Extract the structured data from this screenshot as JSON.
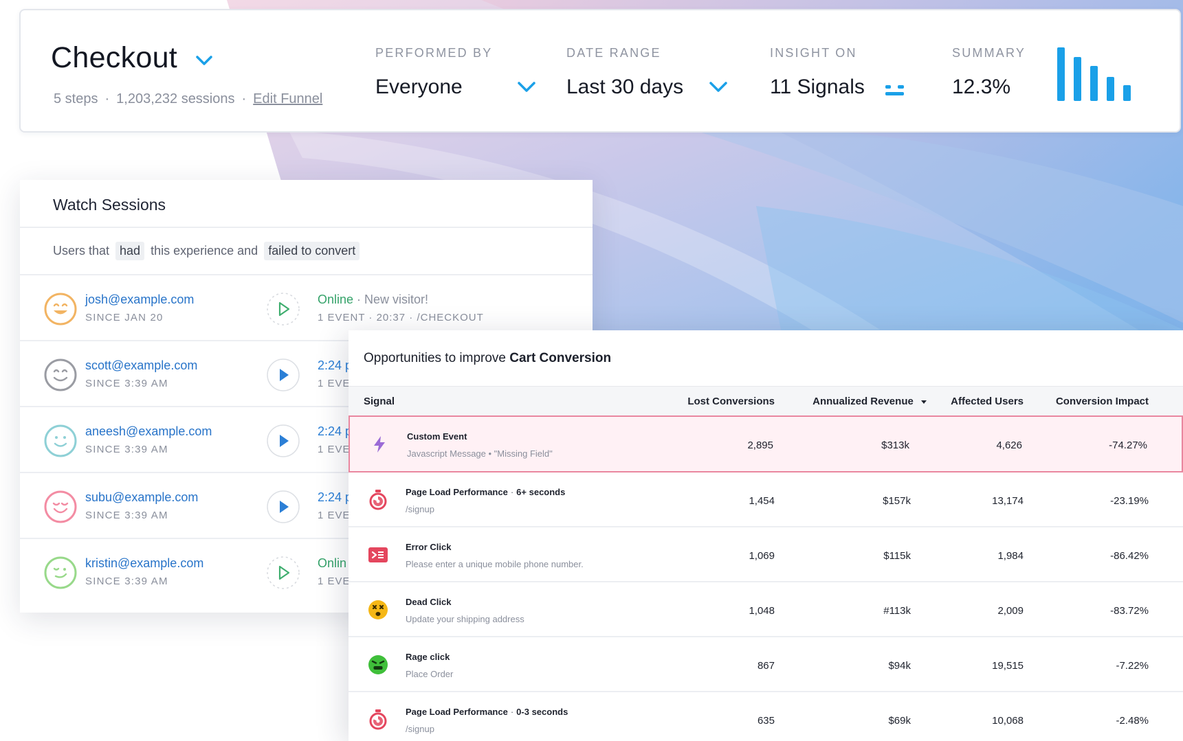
{
  "funnel": {
    "title": "Checkout",
    "steps": "5 steps",
    "sessions": "1,203,232 sessions",
    "edit_link": "Edit Funnel"
  },
  "filters": {
    "performed_by": {
      "label": "PERFORMED BY",
      "value": "Everyone"
    },
    "date_range": {
      "label": "DATE RANGE",
      "value": "Last 30 days"
    },
    "insight_on": {
      "label": "INSIGHT ON",
      "value": "11 Signals"
    },
    "summary": {
      "label": "SUMMARY",
      "value": "12.3%",
      "bar_levels": [
        1.0,
        0.82,
        0.65,
        0.45,
        0.3
      ]
    }
  },
  "watch_sessions": {
    "title": "Watch Sessions",
    "filter": {
      "prefix": "Users that",
      "chip1": "had",
      "middle": "this experience and",
      "chip2": "failed to convert"
    },
    "rows": [
      {
        "email": "josh@example.com",
        "since": "SINCE JAN 20",
        "status_main": "Online",
        "status_rest": " · New visitor!",
        "event": "1 EVENT · 20:37 · /CHECKOUT",
        "avatar_color": "#f2b463",
        "live": true
      },
      {
        "email": "scott@example.com",
        "since": "SINCE 3:39 AM",
        "status_main": "2:24 p",
        "status_rest": "",
        "event": "1 EVEN",
        "avatar_color": "#9a9ca3",
        "live": false
      },
      {
        "email": "aneesh@example.com",
        "since": "SINCE 3:39 AM",
        "status_main": "2:24 p",
        "status_rest": "",
        "event": "1 EVEN",
        "avatar_color": "#8ed0d6",
        "live": false
      },
      {
        "email": "subu@example.com",
        "since": "SINCE 3:39 AM",
        "status_main": "2:24 p",
        "status_rest": "",
        "event": "1 EVEN",
        "avatar_color": "#f38ca3",
        "live": false
      },
      {
        "email": "kristin@example.com",
        "since": "SINCE 3:39 AM",
        "status_main": "Onlin",
        "status_rest": "",
        "event": "1 EVEN",
        "avatar_color": "#98d98a",
        "live": true
      }
    ]
  },
  "opportunities": {
    "title_prefix": "Opportunities to improve ",
    "title_bold": "Cart Conversion",
    "columns": {
      "signal": "Signal",
      "lost": "Lost Conversions",
      "revenue": "Annualized Revenue",
      "affected": "Affected Users",
      "impact": "Conversion Impact"
    },
    "rows": [
      {
        "name": "Custom Event",
        "detail": "",
        "desc": "Javascript  Message • \"Missing Field\"",
        "lost": "2,895",
        "revenue": "$313k",
        "affected": "4,626",
        "impact": "-74.27%",
        "icon": "bolt-icon"
      },
      {
        "name": "Page Load Performance",
        "detail": "6+ seconds",
        "desc": "/signup",
        "lost": "1,454",
        "revenue": "$157k",
        "affected": "13,174",
        "impact": "-23.19%",
        "icon": "stopwatch-icon"
      },
      {
        "name": "Error Click",
        "detail": "",
        "desc": "Please enter a unique mobile phone number.",
        "lost": "1,069",
        "revenue": "$115k",
        "affected": "1,984",
        "impact": "-86.42%",
        "icon": "error-console-icon"
      },
      {
        "name": "Dead Click",
        "detail": "",
        "desc": "Update your shipping address",
        "lost": "1,048",
        "revenue": "#113k",
        "affected": "2,009",
        "impact": "-83.72%",
        "icon": "dead-face-icon"
      },
      {
        "name": "Rage click",
        "detail": "",
        "desc": "Place Order",
        "lost": "867",
        "revenue": "$94k",
        "affected": "19,515",
        "impact": "-7.22%",
        "icon": "angry-face-icon"
      },
      {
        "name": "Page Load Performance",
        "detail": "0-3 seconds",
        "desc": "/signup",
        "lost": "635",
        "revenue": "$69k",
        "affected": "10,068",
        "impact": "-2.48%",
        "icon": "stopwatch-icon"
      }
    ]
  },
  "colors": {
    "accent": "#1aa0e8",
    "link": "#2874c9",
    "online": "#35a36a",
    "highlight_border": "#e9879f",
    "highlight_bg": "#fff1f5"
  }
}
